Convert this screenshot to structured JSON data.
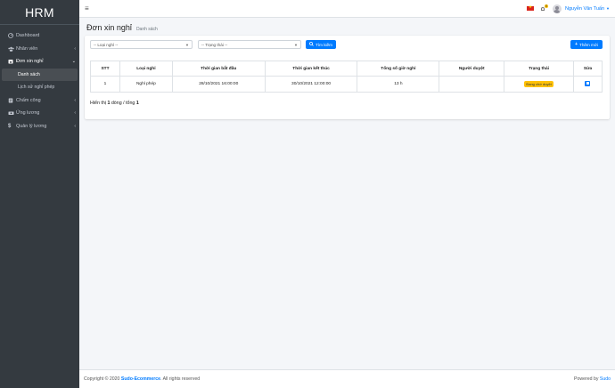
{
  "brand": "HRM",
  "sidebar": {
    "items": [
      {
        "label": "Dashboard",
        "icon": "dashboard-icon"
      },
      {
        "label": "Nhân viên",
        "icon": "users-icon"
      },
      {
        "label": "Đơn xin nghỉ",
        "icon": "calendar-x-icon",
        "open": true
      },
      {
        "label": "Chấm công",
        "icon": "clock-icon"
      },
      {
        "label": "Ứng lương",
        "icon": "money-icon"
      },
      {
        "label": "Quản lý lương",
        "icon": "dollar-icon"
      }
    ],
    "sub_items": [
      {
        "label": "Danh sách",
        "active": true
      },
      {
        "label": "Lịch sử nghỉ phép",
        "active": false
      }
    ]
  },
  "topbar": {
    "user_name": "Nguyễn Văn Tuấn",
    "notification_count": "0"
  },
  "header": {
    "title": "Đơn xin nghỉ",
    "subtitle": "Danh sách"
  },
  "filters": {
    "leave_type": "-- Loại nghỉ --",
    "status": "-- Trạng thái --",
    "search_label": "Tìm kiếm",
    "add_label": "Thêm mới"
  },
  "table": {
    "columns": [
      "STT",
      "Loại nghỉ",
      "Thời gian bắt đầu",
      "Thời gian kết thúc",
      "Tổng số giờ nghỉ",
      "Người duyệt",
      "Trạng thái",
      "Sửa"
    ],
    "rows": [
      {
        "stt": "1",
        "type": "Nghỉ phép",
        "start": "28/10/2021 16:00:00",
        "end": "30/10/2021 12:00:00",
        "hours": "13 h",
        "approver": "",
        "status": "Đang chờ duyệt"
      }
    ]
  },
  "summary": {
    "prefix": "Hiển thị ",
    "shown": "1",
    "middle": " dòng / tổng ",
    "total": "1"
  },
  "footer": {
    "copyright_prefix": "Copyright © 2020 ",
    "company": "Sudo-Ecommerce",
    "copyright_suffix": ". All rights reserved",
    "powered_prefix": "Powered by ",
    "powered_by": "Sudo"
  },
  "colors": {
    "sidebar_bg": "#343a40",
    "primary": "#007bff",
    "warning": "#ffc107"
  }
}
